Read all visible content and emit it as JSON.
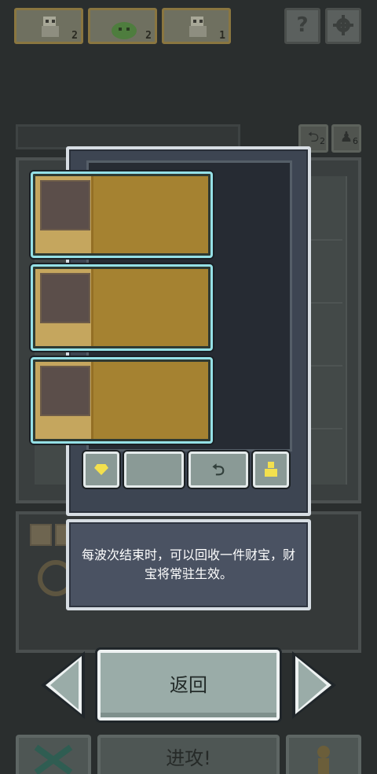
{
  "top_units": [
    {
      "icon": "robot-unit-icon",
      "count": "2"
    },
    {
      "icon": "slime-unit-icon",
      "count": "2"
    },
    {
      "icon": "robot-unit-icon",
      "count": "1"
    }
  ],
  "top_buttons": {
    "help": "?",
    "settings_icon": "gear-icon"
  },
  "badges": [
    {
      "icon": "recycle-icon",
      "count": "2"
    },
    {
      "icon": "person-icon",
      "count": "6"
    }
  ],
  "modal": {
    "cards": 3,
    "actions": [
      {
        "icon": "gem-icon",
        "label": ""
      },
      {
        "icon": "",
        "label": ""
      },
      {
        "icon": "recycle-icon",
        "label": "⮌"
      },
      {
        "icon": "person-icon",
        "label": ""
      }
    ]
  },
  "tooltip": {
    "text": "每波次结束时，可以回收一件财宝，财宝将常驻生效。"
  },
  "navigation": {
    "back_label": "返回"
  },
  "bottom_bar": {
    "attack_label": "进攻!"
  },
  "colors": {
    "card_gold": "#a58231",
    "card_border": "#95e0e6",
    "modal_bg": "#3d4552",
    "accent_yellow": "#f3e04e",
    "button_green": "#9aaca8"
  }
}
